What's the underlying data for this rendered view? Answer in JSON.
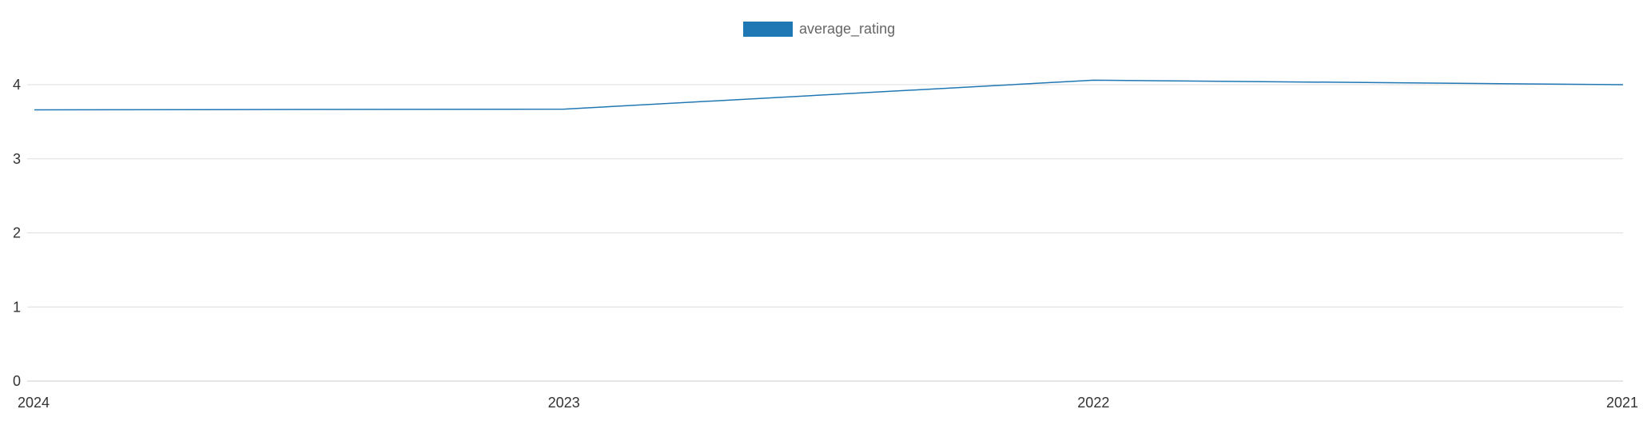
{
  "chart_data": {
    "type": "line",
    "categories": [
      "2024",
      "2023",
      "2022",
      "2021"
    ],
    "series": [
      {
        "name": "average_rating",
        "values": [
          3.66,
          3.67,
          4.06,
          4.0
        ],
        "color": "#1f77b4"
      }
    ],
    "ylim": [
      0,
      4
    ],
    "yticks": [
      "0",
      "1",
      "2",
      "3",
      "4"
    ],
    "grid": true,
    "legend_position": "top-center",
    "grid_color": "#dddddd",
    "axis_color": "#cccccc"
  }
}
